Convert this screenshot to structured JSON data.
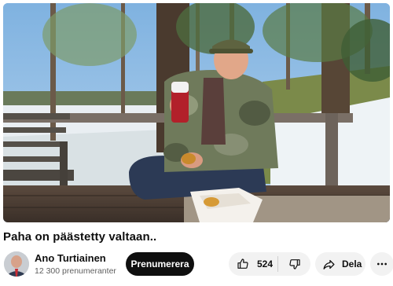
{
  "video": {
    "title": "Paha on päästetty valtaan.."
  },
  "channel": {
    "name": "Ano Turtiainen",
    "subscribers": "12 300 prenumeranter",
    "subscribe_label": "Prenumerera"
  },
  "actions": {
    "like_count": "524",
    "share_label": "Dela"
  },
  "icons": {
    "like": "thumbs-up-icon",
    "dislike": "thumbs-down-icon",
    "share": "share-arrow-icon",
    "more": "more-horizontal-icon"
  },
  "colors": {
    "subscribe_bg": "#0f0f0f",
    "pill_bg": "#f2f2f2",
    "secondary_text": "#606060"
  }
}
